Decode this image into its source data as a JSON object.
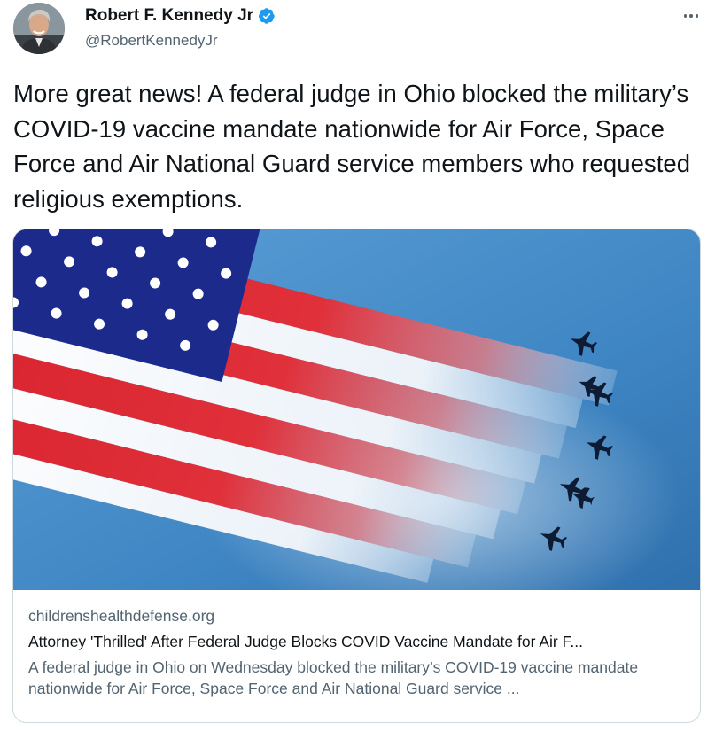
{
  "author": {
    "name": "Robert F. Kennedy Jr",
    "handle": "@RobertKennedyJr",
    "verified": true,
    "avatar_icon": "profile-photo-icon"
  },
  "menu": {
    "icon": "more-horizontal-icon"
  },
  "tweet": {
    "text": "More great news! A federal judge in Ohio blocked the military’s COVID-19 vaccine mandate nationwide for Air Force, Space Force and Air National Guard service members who requested religious exemptions."
  },
  "link_card": {
    "image_icon": "flag-contrail-jets-image",
    "domain": "childrenshealthdefense.org",
    "title": "Attorney 'Thrilled' After Federal Judge Blocks COVID Vaccine Mandate for Air F...",
    "description": "A federal judge in Ohio on Wednesday blocked the military’s COVID-19 vaccine mandate nationwide for Air Force, Space Force and Air National Guard service ..."
  },
  "colors": {
    "text": "#0f1419",
    "secondary": "#536471",
    "border": "#cfd9de",
    "verified_badge": "#1d9bf0",
    "flag_blue": "#1c2a8c",
    "flag_red": "#d8232e",
    "sky": "#3f86c4"
  }
}
